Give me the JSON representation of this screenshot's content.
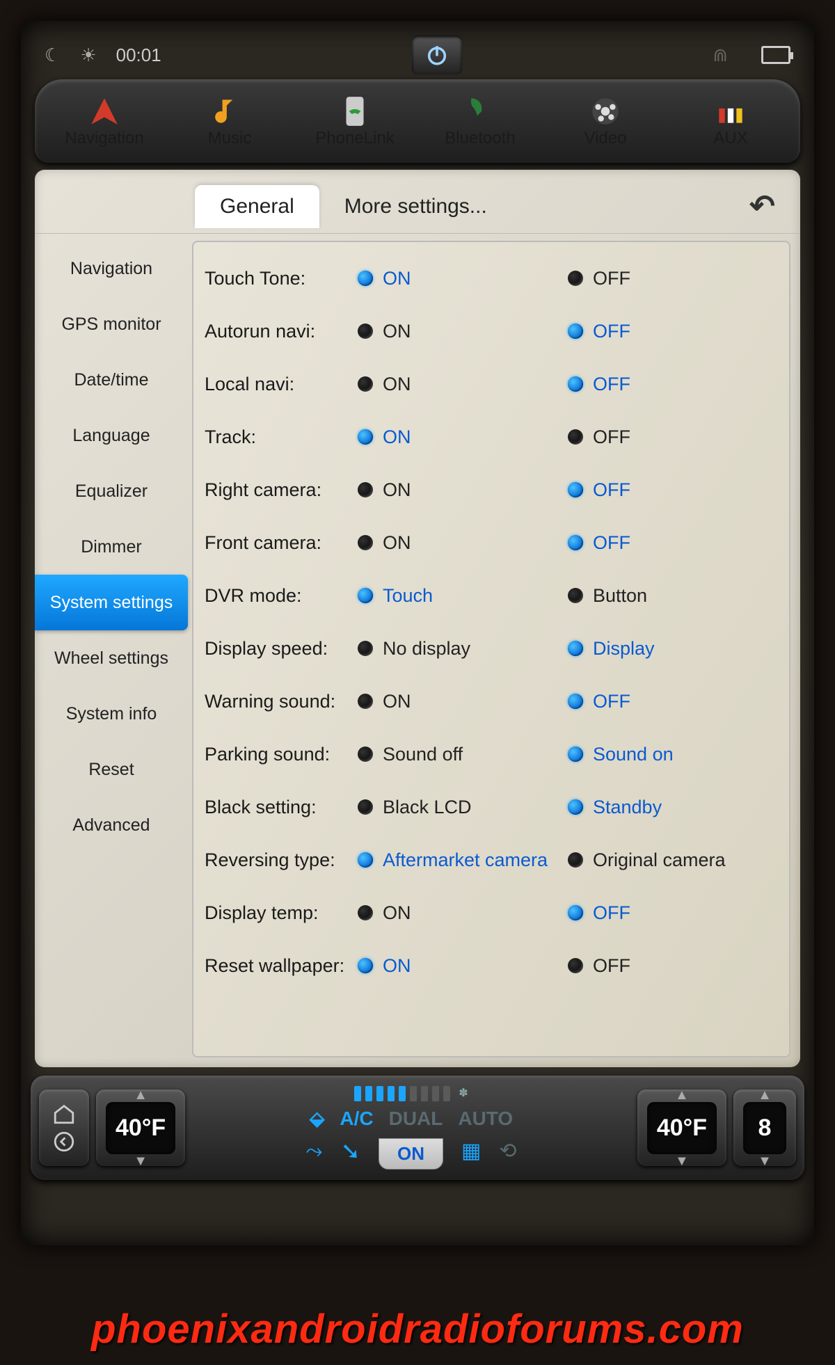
{
  "status": {
    "time": "00:01"
  },
  "dock": {
    "items": [
      {
        "label": "Navigation"
      },
      {
        "label": "Music"
      },
      {
        "label": "PhoneLink"
      },
      {
        "label": "Bluetooth"
      },
      {
        "label": "Video"
      },
      {
        "label": "AUX"
      }
    ]
  },
  "tabs": {
    "general": "General",
    "more": "More settings..."
  },
  "sidebar": [
    "Navigation",
    "GPS monitor",
    "Date/time",
    "Language",
    "Equalizer",
    "Dimmer",
    "System settings",
    "Wheel settings",
    "System info",
    "Reset",
    "Advanced"
  ],
  "settings": [
    {
      "label": "Touch Tone:",
      "opt1": "ON",
      "opt2": "OFF",
      "sel": 1
    },
    {
      "label": "Autorun navi:",
      "opt1": "ON",
      "opt2": "OFF",
      "sel": 2
    },
    {
      "label": "Local navi:",
      "opt1": "ON",
      "opt2": "OFF",
      "sel": 2
    },
    {
      "label": "Track:",
      "opt1": "ON",
      "opt2": "OFF",
      "sel": 1
    },
    {
      "label": "Right camera:",
      "opt1": "ON",
      "opt2": "OFF",
      "sel": 2
    },
    {
      "label": "Front camera:",
      "opt1": "ON",
      "opt2": "OFF",
      "sel": 2
    },
    {
      "label": "DVR mode:",
      "opt1": "Touch",
      "opt2": "Button",
      "sel": 1
    },
    {
      "label": "Display speed:",
      "opt1": "No display",
      "opt2": "Display",
      "sel": 2
    },
    {
      "label": "Warning sound:",
      "opt1": "ON",
      "opt2": "OFF",
      "sel": 2
    },
    {
      "label": "Parking sound:",
      "opt1": "Sound off",
      "opt2": "Sound on",
      "sel": 2
    },
    {
      "label": "Black setting:",
      "opt1": "Black LCD",
      "opt2": "Standby",
      "sel": 2
    },
    {
      "label": "Reversing type:",
      "opt1": "Aftermarket camera",
      "opt2": "Original camera",
      "sel": 1
    },
    {
      "label": "Display temp:",
      "opt1": "ON",
      "opt2": "OFF",
      "sel": 2
    },
    {
      "label": "Reset wallpaper:",
      "opt1": "ON",
      "opt2": "OFF",
      "sel": 1
    }
  ],
  "climate": {
    "temp_left": "40°F",
    "temp_right": "40°F",
    "fan": "8",
    "ac": "A/C",
    "dual": "DUAL",
    "auto": "AUTO",
    "on": "ON"
  },
  "watermark": "phoenixandroidradioforums.com"
}
